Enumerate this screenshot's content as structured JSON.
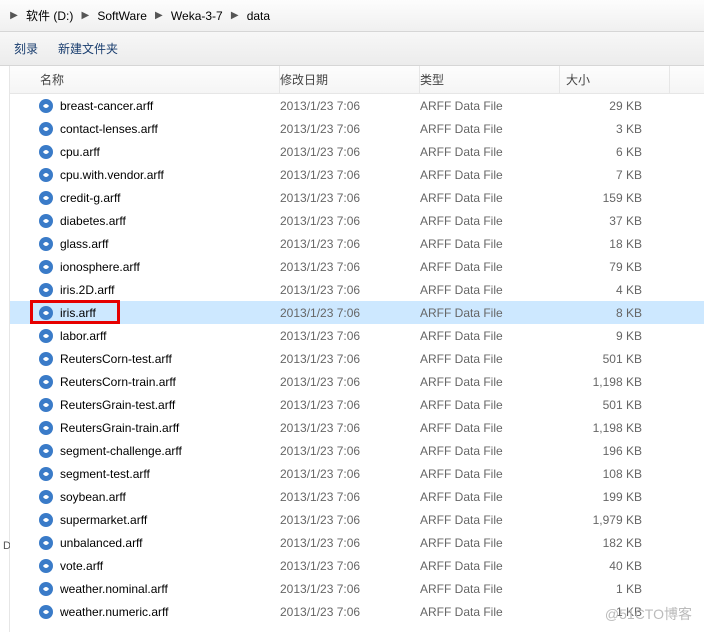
{
  "breadcrumb": {
    "parts": [
      "软件 (D:)",
      "SoftWare",
      "Weka-3-7",
      "data"
    ]
  },
  "toolbar": {
    "burn": "刻录",
    "new_folder": "新建文件夹"
  },
  "sidebar": {
    "drive_hint": "D Dr"
  },
  "columns": {
    "name": "名称",
    "date": "修改日期",
    "type": "类型",
    "size": "大小"
  },
  "files": [
    {
      "name": "breast-cancer.arff",
      "date": "2013/1/23 7:06",
      "type": "ARFF Data File",
      "size": "29 KB",
      "selected": false,
      "highlighted": false
    },
    {
      "name": "contact-lenses.arff",
      "date": "2013/1/23 7:06",
      "type": "ARFF Data File",
      "size": "3 KB",
      "selected": false,
      "highlighted": false
    },
    {
      "name": "cpu.arff",
      "date": "2013/1/23 7:06",
      "type": "ARFF Data File",
      "size": "6 KB",
      "selected": false,
      "highlighted": false
    },
    {
      "name": "cpu.with.vendor.arff",
      "date": "2013/1/23 7:06",
      "type": "ARFF Data File",
      "size": "7 KB",
      "selected": false,
      "highlighted": false
    },
    {
      "name": "credit-g.arff",
      "date": "2013/1/23 7:06",
      "type": "ARFF Data File",
      "size": "159 KB",
      "selected": false,
      "highlighted": false
    },
    {
      "name": "diabetes.arff",
      "date": "2013/1/23 7:06",
      "type": "ARFF Data File",
      "size": "37 KB",
      "selected": false,
      "highlighted": false
    },
    {
      "name": "glass.arff",
      "date": "2013/1/23 7:06",
      "type": "ARFF Data File",
      "size": "18 KB",
      "selected": false,
      "highlighted": false
    },
    {
      "name": "ionosphere.arff",
      "date": "2013/1/23 7:06",
      "type": "ARFF Data File",
      "size": "79 KB",
      "selected": false,
      "highlighted": false
    },
    {
      "name": "iris.2D.arff",
      "date": "2013/1/23 7:06",
      "type": "ARFF Data File",
      "size": "4 KB",
      "selected": false,
      "highlighted": false
    },
    {
      "name": "iris.arff",
      "date": "2013/1/23 7:06",
      "type": "ARFF Data File",
      "size": "8 KB",
      "selected": true,
      "highlighted": true
    },
    {
      "name": "labor.arff",
      "date": "2013/1/23 7:06",
      "type": "ARFF Data File",
      "size": "9 KB",
      "selected": false,
      "highlighted": false
    },
    {
      "name": "ReutersCorn-test.arff",
      "date": "2013/1/23 7:06",
      "type": "ARFF Data File",
      "size": "501 KB",
      "selected": false,
      "highlighted": false
    },
    {
      "name": "ReutersCorn-train.arff",
      "date": "2013/1/23 7:06",
      "type": "ARFF Data File",
      "size": "1,198 KB",
      "selected": false,
      "highlighted": false
    },
    {
      "name": "ReutersGrain-test.arff",
      "date": "2013/1/23 7:06",
      "type": "ARFF Data File",
      "size": "501 KB",
      "selected": false,
      "highlighted": false
    },
    {
      "name": "ReutersGrain-train.arff",
      "date": "2013/1/23 7:06",
      "type": "ARFF Data File",
      "size": "1,198 KB",
      "selected": false,
      "highlighted": false
    },
    {
      "name": "segment-challenge.arff",
      "date": "2013/1/23 7:06",
      "type": "ARFF Data File",
      "size": "196 KB",
      "selected": false,
      "highlighted": false
    },
    {
      "name": "segment-test.arff",
      "date": "2013/1/23 7:06",
      "type": "ARFF Data File",
      "size": "108 KB",
      "selected": false,
      "highlighted": false
    },
    {
      "name": "soybean.arff",
      "date": "2013/1/23 7:06",
      "type": "ARFF Data File",
      "size": "199 KB",
      "selected": false,
      "highlighted": false
    },
    {
      "name": "supermarket.arff",
      "date": "2013/1/23 7:06",
      "type": "ARFF Data File",
      "size": "1,979 KB",
      "selected": false,
      "highlighted": false
    },
    {
      "name": "unbalanced.arff",
      "date": "2013/1/23 7:06",
      "type": "ARFF Data File",
      "size": "182 KB",
      "selected": false,
      "highlighted": false
    },
    {
      "name": "vote.arff",
      "date": "2013/1/23 7:06",
      "type": "ARFF Data File",
      "size": "40 KB",
      "selected": false,
      "highlighted": false
    },
    {
      "name": "weather.nominal.arff",
      "date": "2013/1/23 7:06",
      "type": "ARFF Data File",
      "size": "1 KB",
      "selected": false,
      "highlighted": false
    },
    {
      "name": "weather.numeric.arff",
      "date": "2013/1/23 7:06",
      "type": "ARFF Data File",
      "size": "1 KB",
      "selected": false,
      "highlighted": false
    }
  ],
  "watermark": "@51CTO博客"
}
